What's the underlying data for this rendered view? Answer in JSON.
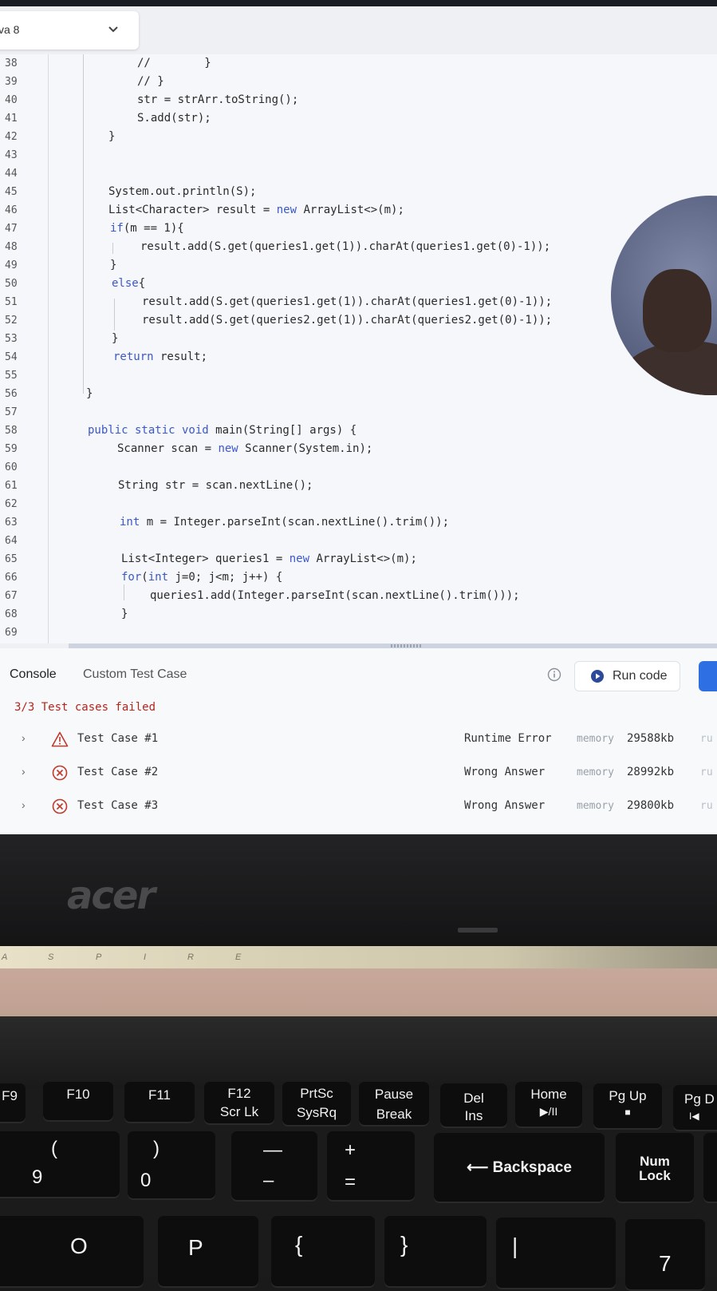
{
  "editor": {
    "language": "va 8",
    "lines": [
      {
        "n": "38",
        "segments": [
          {
            "t": "//        }",
            "c": "code"
          }
        ]
      },
      {
        "n": "39",
        "segments": [
          {
            "t": "// }",
            "c": "code"
          }
        ]
      },
      {
        "n": "40",
        "segments": [
          {
            "t": "str = strArr.toString();",
            "c": "code"
          }
        ]
      },
      {
        "n": "41",
        "segments": [
          {
            "t": "S.add(str);",
            "c": "code"
          }
        ]
      },
      {
        "n": "42",
        "segments": [
          {
            "t": "}",
            "c": "code"
          }
        ]
      },
      {
        "n": "43",
        "segments": []
      },
      {
        "n": "44",
        "segments": []
      },
      {
        "n": "45",
        "segments": [
          {
            "t": "System.out.println(S);",
            "c": "code"
          }
        ]
      },
      {
        "n": "46",
        "segments": [
          {
            "t": "List<Character> result = ",
            "c": "code"
          },
          {
            "t": "new",
            "c": "kw"
          },
          {
            "t": " ArrayList<>(m);",
            "c": "code"
          }
        ]
      },
      {
        "n": "47",
        "segments": [
          {
            "t": "if",
            "c": "kw"
          },
          {
            "t": "(m == 1){",
            "c": "code"
          }
        ]
      },
      {
        "n": "48",
        "segments": [
          {
            "t": "result.add(S.get(queries1.get(1)).charAt(queries1.get(0)-1));",
            "c": "code"
          }
        ]
      },
      {
        "n": "49",
        "segments": [
          {
            "t": "}",
            "c": "code"
          }
        ]
      },
      {
        "n": "50",
        "segments": [
          {
            "t": "else",
            "c": "kw"
          },
          {
            "t": "{",
            "c": "code"
          }
        ]
      },
      {
        "n": "51",
        "segments": [
          {
            "t": "result.add(S.get(queries1.get(1)).charAt(queries1.get(0)-1));",
            "c": "code"
          }
        ]
      },
      {
        "n": "52",
        "segments": [
          {
            "t": "result.add(S.get(queries2.get(1)).charAt(queries2.get(0)-1));",
            "c": "code"
          }
        ]
      },
      {
        "n": "53",
        "segments": [
          {
            "t": "}",
            "c": "code"
          }
        ]
      },
      {
        "n": "54",
        "segments": [
          {
            "t": "return",
            "c": "kw"
          },
          {
            "t": " result;",
            "c": "code"
          }
        ]
      },
      {
        "n": "55",
        "segments": []
      },
      {
        "n": "56",
        "segments": [
          {
            "t": "}",
            "c": "code"
          }
        ]
      },
      {
        "n": "57",
        "segments": []
      },
      {
        "n": "58",
        "segments": [
          {
            "t": "public static void",
            "c": "kw"
          },
          {
            "t": " main(String[] args) {",
            "c": "code"
          }
        ]
      },
      {
        "n": "59",
        "segments": [
          {
            "t": "Scanner scan = ",
            "c": "code"
          },
          {
            "t": "new",
            "c": "kw"
          },
          {
            "t": " Scanner(System.in);",
            "c": "code"
          }
        ]
      },
      {
        "n": "60",
        "segments": []
      },
      {
        "n": "61",
        "segments": [
          {
            "t": "String str = scan.nextLine();",
            "c": "code"
          }
        ]
      },
      {
        "n": "62",
        "segments": []
      },
      {
        "n": "63",
        "segments": [
          {
            "t": "int",
            "c": "kw"
          },
          {
            "t": " m = Integer.parseInt(scan.nextLine().trim());",
            "c": "code"
          }
        ]
      },
      {
        "n": "64",
        "segments": []
      },
      {
        "n": "65",
        "segments": [
          {
            "t": "List<Integer> queries1 = ",
            "c": "code"
          },
          {
            "t": "new",
            "c": "kw"
          },
          {
            "t": " ArrayList<>(m);",
            "c": "code"
          }
        ]
      },
      {
        "n": "66",
        "segments": [
          {
            "t": "for",
            "c": "kw"
          },
          {
            "t": "(",
            "c": "code"
          },
          {
            "t": "int",
            "c": "kw"
          },
          {
            "t": " j=0; j<m; j++) {",
            "c": "code"
          }
        ]
      },
      {
        "n": "67",
        "segments": [
          {
            "t": "queries1.add(Integer.parseInt(scan.nextLine().trim()));",
            "c": "code"
          }
        ]
      },
      {
        "n": "68",
        "segments": [
          {
            "t": "}",
            "c": "code"
          }
        ]
      },
      {
        "n": "69",
        "segments": []
      }
    ]
  },
  "console": {
    "tabs": [
      "Console",
      "Custom Test Case"
    ],
    "run_label": "Run code",
    "status": "3/3 Test cases failed",
    "memory_label": "memory",
    "runtime_label": "ru",
    "test_cases": [
      {
        "name": "Test Case #1",
        "result": "Runtime Error",
        "memory": "29588kb",
        "icon": "warning-icon"
      },
      {
        "name": "Test Case #2",
        "result": "Wrong Answer",
        "memory": "28992kb",
        "icon": "error-circle-icon"
      },
      {
        "name": "Test Case #3",
        "result": "Wrong Answer",
        "memory": "29800kb",
        "icon": "error-circle-icon"
      }
    ]
  },
  "laptop": {
    "brand": "acer",
    "hinge_labels": [
      "A",
      "S",
      "P",
      "I",
      "R",
      "E"
    ],
    "keys": {
      "f9": "F9",
      "f10": "F10",
      "f11": "F11",
      "f12": [
        "F12",
        "Scr Lk"
      ],
      "prtsc": [
        "PrtSc",
        "SysRq"
      ],
      "pause": [
        "Pause",
        "Break"
      ],
      "del": [
        "Del",
        "Ins"
      ],
      "home": [
        "Home",
        "▶/II"
      ],
      "pgup": [
        "Pg Up",
        "■"
      ],
      "pgdn": [
        "Pg D",
        "I◀"
      ],
      "nine": [
        "(",
        "9"
      ],
      "zero": [
        ")",
        "0"
      ],
      "minus": [
        "—",
        "–"
      ],
      "equal": [
        "+",
        "="
      ],
      "backspace": "⟵ Backspace",
      "numlock": [
        "Num",
        "Lock"
      ],
      "o": "O",
      "p": "P",
      "lbrace": "{",
      "rbrace": "}",
      "pipe": "|",
      "seven": "7"
    }
  },
  "colors": {
    "keyword": "#3a58c9",
    "error_text": "#b3261e",
    "run_accent": "#2f6fe4"
  }
}
